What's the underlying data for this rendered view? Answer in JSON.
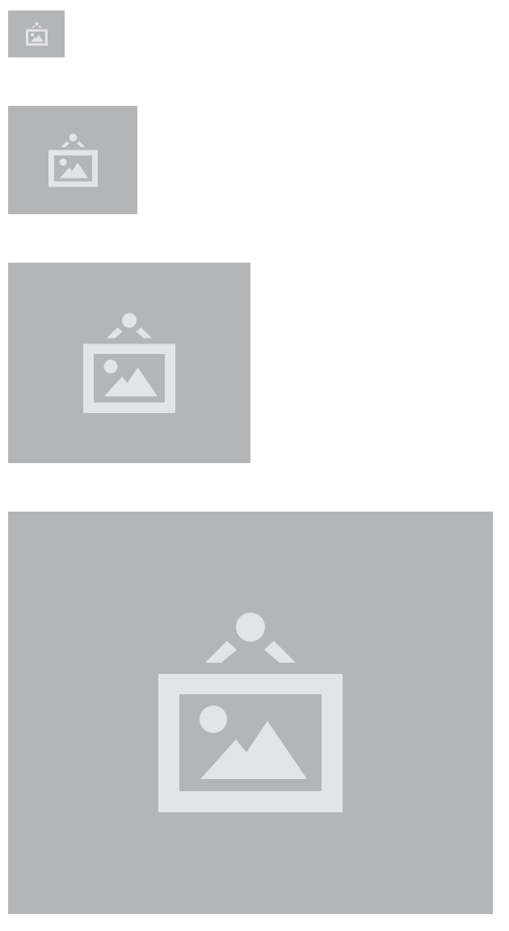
{
  "placeholders": [
    {
      "icon": "image-placeholder-icon",
      "background": "#b4b5b7",
      "icon_color": "#e3e4e5"
    },
    {
      "icon": "image-placeholder-icon",
      "background": "#b4b5b7",
      "icon_color": "#e3e4e5"
    },
    {
      "icon": "image-placeholder-icon",
      "background": "#b4b5b7",
      "icon_color": "#e3e4e5"
    },
    {
      "icon": "image-placeholder-icon",
      "background": "#b4b5b7",
      "icon_color": "#e3e4e5"
    }
  ]
}
